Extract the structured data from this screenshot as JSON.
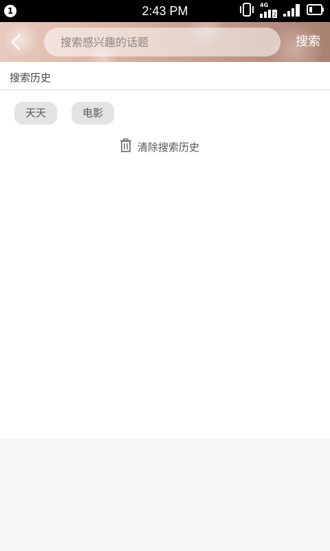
{
  "status_bar": {
    "notification_count": "1",
    "time": "2:43 PM",
    "network_label": "4G",
    "icons": [
      "vibrate-icon",
      "signal-4g-icon",
      "signal-icon",
      "battery-icon"
    ]
  },
  "header": {
    "back_icon": "chevron-left-icon",
    "search_placeholder": "搜索感兴趣的话题",
    "search_value": "",
    "search_button_label": "搜索"
  },
  "history": {
    "title": "搜索历史",
    "items": [
      {
        "label": "天天"
      },
      {
        "label": "电影"
      }
    ],
    "clear_label": "清除搜索历史",
    "clear_icon": "trash-icon"
  },
  "colors": {
    "status_bar_bg": "#000000",
    "chip_bg": "#e3e3e3",
    "page_bg": "#f7f7f7"
  }
}
